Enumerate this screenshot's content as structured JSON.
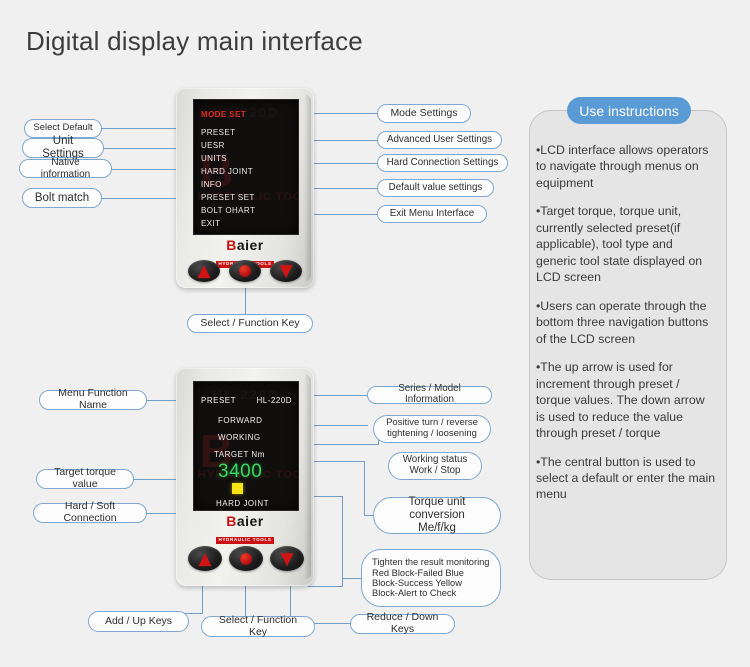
{
  "page": {
    "title": "Digital display main interface",
    "background_color": "#f0f0f0",
    "accent_color": "#5b9bd5",
    "callout_border_color": "#7fa8d0"
  },
  "top_device": {
    "brand": {
      "initial": "B",
      "rest": "aier",
      "tagline": "HYDRAULIC TOOLS"
    },
    "lcd_menu": [
      {
        "label": "MODE  SET",
        "color": "#e02b1c",
        "highlight": true
      },
      {
        "label": "PRESET",
        "color": "#e8e8e8",
        "highlight": false
      },
      {
        "label": "UESR",
        "color": "#e8e8e8",
        "highlight": false
      },
      {
        "label": "UNITS",
        "color": "#e8e8e8",
        "highlight": false
      },
      {
        "label": "HARD JOINT",
        "color": "#e8e8e8",
        "highlight": false
      },
      {
        "label": "INFO",
        "color": "#e8e8e8",
        "highlight": false
      },
      {
        "label": "PRESET   SET",
        "color": "#e8e8e8",
        "highlight": false
      },
      {
        "label": "BOLT  OHART",
        "color": "#e8e8e8",
        "highlight": false
      },
      {
        "label": "EXIT",
        "color": "#e8e8e8",
        "highlight": false
      }
    ],
    "watermark": {
      "big": "B",
      "small": "HYDRAULIC TOOLS",
      "ghost": "HL-220D"
    },
    "buttons": {
      "up": "⬆",
      "center": "●",
      "down": "⬇"
    },
    "left_labels": [
      {
        "text": "Select Default"
      },
      {
        "text": "Unit Settings"
      },
      {
        "text": "Native information"
      },
      {
        "text": "Bolt match"
      }
    ],
    "right_labels": [
      {
        "text": "Mode Settings"
      },
      {
        "text": "Advanced User Settings"
      },
      {
        "text": "Hard Connection Settings"
      },
      {
        "text": "Default value settings"
      },
      {
        "text": "Exit Menu Interface"
      }
    ],
    "bottom_label": "Select / Function Key"
  },
  "bottom_device": {
    "brand": {
      "initial": "B",
      "rest": "aier",
      "tagline": "HYDRAULIC TOOLS"
    },
    "lcd": {
      "menu_name": "PRESET",
      "model": "HL-220D",
      "direction": "FORWARD",
      "working_status": "WORKING",
      "target_label": "TARGET  Nm",
      "target_value": "3400",
      "target_value_color": "#3bd660",
      "status_block_color": "#f7e415",
      "joint_mode": "HARD  JOINT"
    },
    "watermark": {
      "big": "B",
      "small": "HYDRAULIC TOOLS",
      "ghost": "HL-220D"
    },
    "left_labels": [
      {
        "text": "Menu Function Name"
      },
      {
        "text": "Target torque value"
      },
      {
        "text": "Hard / Soft Connection"
      }
    ],
    "right_labels": [
      {
        "text": "Series / Model Information"
      },
      {
        "text": "Positive turn / reverse\ntightening / loosening"
      },
      {
        "text": "Working status\nWork / Stop"
      },
      {
        "text": "Torque unit conversion\nMe/f/kg"
      },
      {
        "text": "Tighten the result monitoring\nRed Block-Failed Blue\nBlock-Success Yellow\nBlock-Alert to Check"
      }
    ],
    "bottom_labels": [
      {
        "text": "Add / Up Keys"
      },
      {
        "text": "Select / Function Key"
      },
      {
        "text": "Reduce / Down Keys"
      }
    ]
  },
  "instructions": {
    "badge": "Use instructions",
    "paragraphs": [
      "•LCD interface allows operators to navigate through menus on equipment",
      "•Target torque, torque unit, currently selected preset(if applicable), tool type and generic tool state displayed on LCD screen",
      "•Users can operate through the bottom three navigation buttons of the LCD screen",
      "•The up arrow is used for increment through preset / torque values. The down arrow is used to reduce the value through preset / torque",
      "•The central button is used to select a default or enter the main menu"
    ]
  }
}
